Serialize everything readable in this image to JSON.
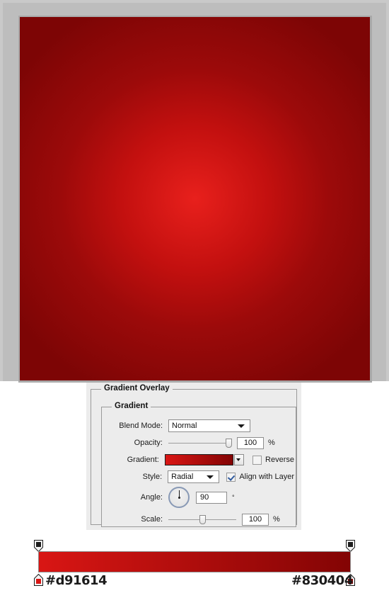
{
  "canvas": {
    "name": "gradient-overlay-preview",
    "center_color": "#e8201c",
    "edge_color": "#7d0505",
    "frame_color": "#c9c9c9"
  },
  "dialog": {
    "outer_group_title": "Gradient Overlay",
    "inner_group_title": "Gradient",
    "rows": {
      "blend_mode": {
        "label": "Blend Mode:",
        "value": "Normal"
      },
      "opacity": {
        "label": "Opacity:",
        "value": "100",
        "unit": "%",
        "slider_percent": 100
      },
      "gradient": {
        "label": "Gradient:",
        "swatch_start": "#d91614",
        "swatch_end": "#830404",
        "reverse_label": "Reverse",
        "reverse_checked": false
      },
      "style": {
        "label": "Style:",
        "value": "Radial",
        "align_label": "Align with Layer",
        "align_checked": true
      },
      "angle": {
        "label": "Angle:",
        "value": "90",
        "unit": "°",
        "degrees": 90
      },
      "scale": {
        "label": "Scale:",
        "value": "100",
        "unit": "%",
        "slider_percent": 50
      }
    }
  },
  "gradient_editor": {
    "name": "gradient-editor-strip",
    "start_hex": "#d91614",
    "end_hex": "#830404",
    "start_label": "#d91614",
    "end_label": "#830404",
    "opacity_stop_color": "#1d1d1d"
  }
}
